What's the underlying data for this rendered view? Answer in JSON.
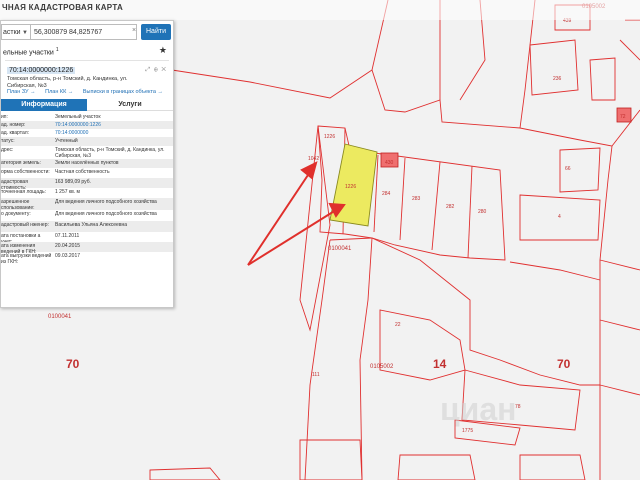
{
  "app": {
    "title": "ЧНАЯ КАДАСТРОВАЯ КАРТА"
  },
  "search": {
    "type_label": "астки",
    "value": "56,300879 84,825767",
    "clear": "×",
    "button": "Найти"
  },
  "section": {
    "title": "ельные участки",
    "superscript": "1"
  },
  "card": {
    "cadastral_id": "70:14:0000000:1226",
    "tools": "⤢ ⊕ ✕",
    "address": "Томская область, р-н Томский, д. Кандинка, ул. Сибирская, №3",
    "links": [
      "План ЗУ →",
      "План КК →",
      "Выписки в границах объекта →"
    ]
  },
  "tabs": {
    "info": "Информация",
    "services": "Услуги"
  },
  "attributes": [
    {
      "label": "ип:",
      "value": "Земельный участок"
    },
    {
      "label": "ад. номер:",
      "value": "70:14:0000000:1226",
      "link": true
    },
    {
      "label": "ад. квартал:",
      "value": "70:14:0000000",
      "link": true
    },
    {
      "label": "татус:",
      "value": "Учтенный"
    },
    {
      "label": "дрес:",
      "value": "Томская область, р-н Томский, д. Кандинка, ул. Сибирская, №3"
    },
    {
      "label": "атегория земель:",
      "value": "Земли населённых пунктов"
    },
    {
      "label": "орма собственности:",
      "value": "Частная собственность"
    },
    {
      "label": "адастровая стоимость:",
      "value": "163 989,09 руб."
    },
    {
      "label": "точненная лощадь:",
      "value": "1 257 кв. м"
    },
    {
      "label": "азрешенное спользование:",
      "value": "Для ведения личного подсобного хозяйства"
    },
    {
      "label": "о документу:",
      "value": "Для ведения личного подсобного хозяйства"
    },
    {
      "label": "адастровый нженер:",
      "value": "Васильева Ульяна Алексеевна"
    },
    {
      "label": "ата постановки а учет:",
      "value": "07.11.2011"
    },
    {
      "label": "ата изменения ведений в ГКН:",
      "value": "20.04.2015"
    },
    {
      "label": "ата выгрузки ведений из ГКН:",
      "value": "09.03.2017"
    }
  ],
  "map": {
    "labels": {
      "top_right_quarter": "0105002",
      "left_quarter": "0100041",
      "under_panel_quarter": "0100041",
      "bottom_quarter": "0105002",
      "district_left": "70",
      "district_center": "14",
      "district_right": "70",
      "highlighted_parcel": "1226",
      "p_top_left": "1226",
      "p_left_narrow": "1042",
      "p_red_small": "430",
      "p_284": "284",
      "p_283": "283",
      "p_282": "282",
      "p_280": "280",
      "p_22": "22",
      "p_111": "111",
      "p_4": "4",
      "p_66": "66",
      "p_439": "439",
      "p_236": "236",
      "p_72": "72",
      "p_78": "78",
      "p_1775": "1775",
      "watermark": "циан"
    },
    "colors": {
      "boundary": "#e03030",
      "highlight_fill": "#ecea60",
      "red_fill": "#ef6f6f",
      "arrow": "#e0302c",
      "label": "#c23030"
    }
  }
}
